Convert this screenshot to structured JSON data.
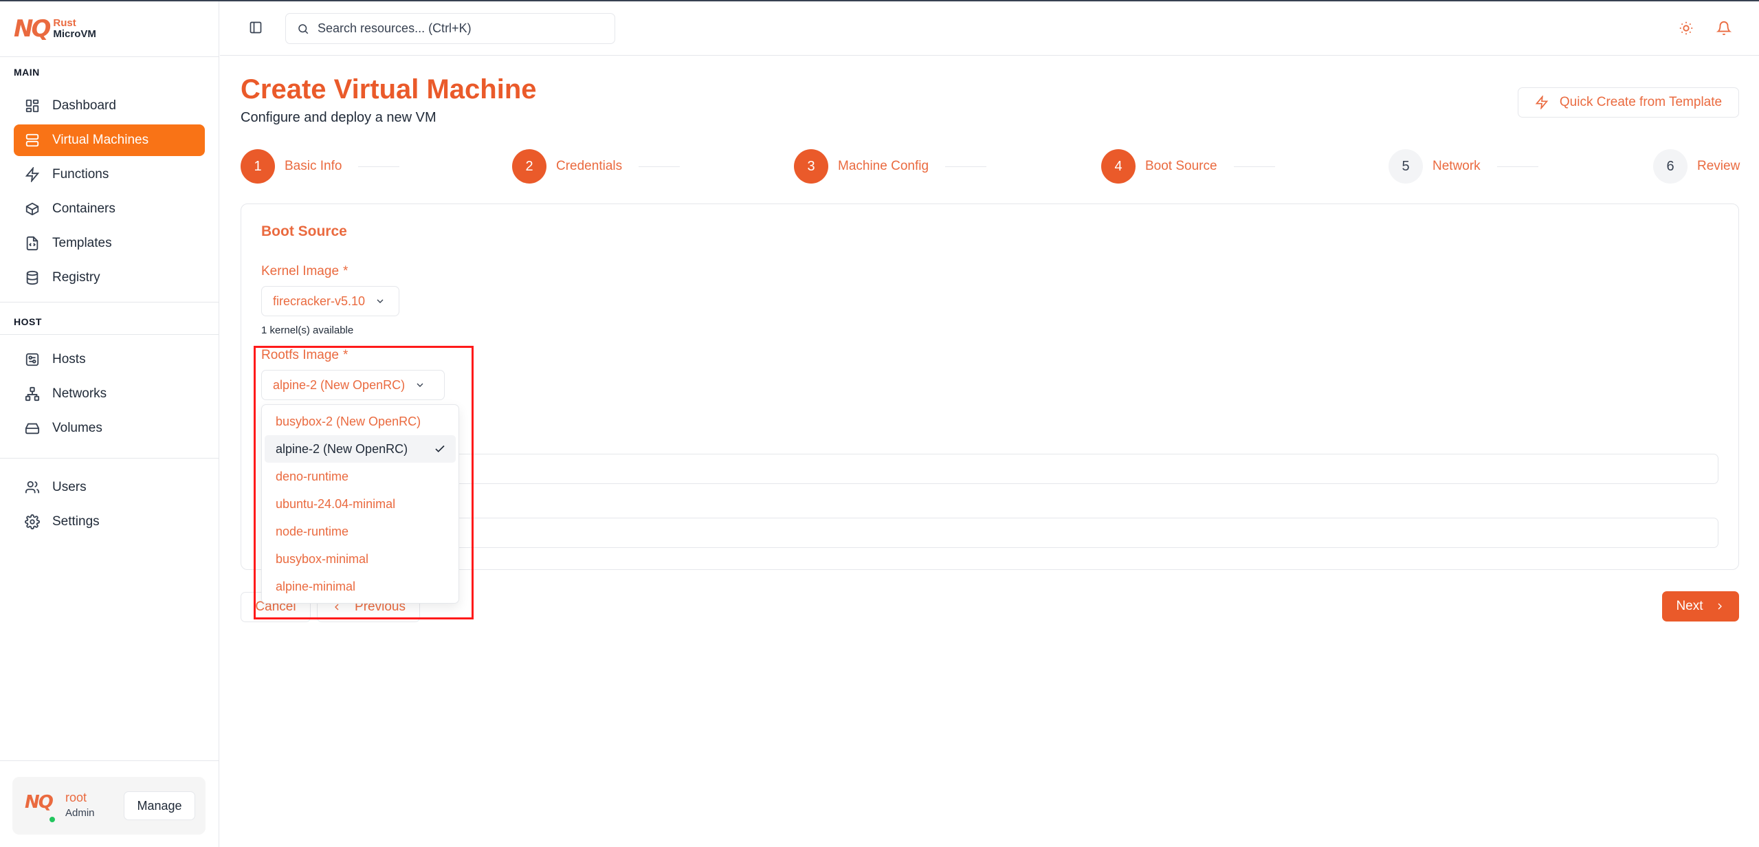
{
  "app": {
    "logo_mark": "NQ",
    "logo_line1": "Rust",
    "logo_line2": "MicroVM"
  },
  "sidebar": {
    "main_label": "MAIN",
    "host_label": "HOST",
    "items": [
      {
        "label": "Dashboard",
        "icon": "dashboard-icon"
      },
      {
        "label": "Virtual Machines",
        "icon": "server-icon",
        "active": true
      },
      {
        "label": "Functions",
        "icon": "zap-icon"
      },
      {
        "label": "Containers",
        "icon": "box-icon"
      },
      {
        "label": "Templates",
        "icon": "file-code-icon"
      },
      {
        "label": "Registry",
        "icon": "database-icon"
      },
      {
        "label": "Hosts",
        "icon": "host-icon"
      },
      {
        "label": "Networks",
        "icon": "network-icon"
      },
      {
        "label": "Volumes",
        "icon": "hard-drive-icon"
      },
      {
        "label": "Users",
        "icon": "users-icon"
      },
      {
        "label": "Settings",
        "icon": "gear-icon"
      }
    ],
    "user": {
      "avatar": "NQ",
      "name": "root",
      "role": "Admin",
      "manage_label": "Manage"
    }
  },
  "header": {
    "search_placeholder": "Search resources... (Ctrl+K)"
  },
  "page": {
    "title": "Create Virtual Machine",
    "subtitle": "Configure and deploy a new VM",
    "quick_create_label": "Quick Create from Template"
  },
  "steps": [
    {
      "num": "1",
      "label": "Basic Info",
      "state": "done"
    },
    {
      "num": "2",
      "label": "Credentials",
      "state": "done"
    },
    {
      "num": "3",
      "label": "Machine Config",
      "state": "done"
    },
    {
      "num": "4",
      "label": "Boot Source",
      "state": "current"
    },
    {
      "num": "5",
      "label": "Network",
      "state": "todo"
    },
    {
      "num": "6",
      "label": "Review",
      "state": "todo"
    }
  ],
  "form": {
    "section_title": "Boot Source",
    "kernel_label": "Kernel Image",
    "kernel_required": "*",
    "kernel_value": "firecracker-v5.10",
    "kernel_hint": "1 kernel(s) available",
    "rootfs_label": "Rootfs Image",
    "rootfs_required": "*",
    "rootfs_value": "alpine-2 (New OpenRC)",
    "rootfs_options": [
      "busybox-2 (New OpenRC)",
      "alpine-2 (New OpenRC)",
      "deno-runtime",
      "ubuntu-24.04-minimal",
      "node-runtime",
      "busybox-minimal",
      "alpine-minimal"
    ],
    "rootfs_selected_index": 1
  },
  "actions": {
    "cancel_label": "Cancel",
    "previous_label": "Previous",
    "next_label": "Next"
  },
  "colors": {
    "accent": "#ea5a2a",
    "active_nav": "#f97316",
    "highlight": "#ff1a1a"
  }
}
